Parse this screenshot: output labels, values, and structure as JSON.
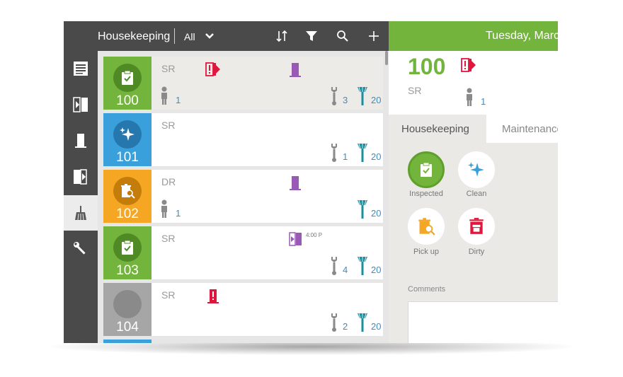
{
  "header": {
    "title": "Housekeeping",
    "filter_label": "All",
    "date": "Tuesday, March"
  },
  "icons": {
    "sort": "sort-icon",
    "filter": "filter-icon",
    "search": "search-icon",
    "add": "plus-icon"
  },
  "sidebar": {
    "items": [
      {
        "name": "list"
      },
      {
        "name": "arrival"
      },
      {
        "name": "stay"
      },
      {
        "name": "departure"
      },
      {
        "name": "housekeeping"
      },
      {
        "name": "maintenance"
      }
    ]
  },
  "rooms": [
    {
      "number": "100",
      "type": "SR",
      "status": "inspected",
      "guests": "1",
      "maintenance": "3",
      "cleaning": "20"
    },
    {
      "number": "101",
      "type": "SR",
      "status": "clean",
      "guests": "",
      "maintenance": "1",
      "cleaning": "20"
    },
    {
      "number": "102",
      "type": "DR",
      "status": "pickup",
      "guests": "1",
      "maintenance": "",
      "cleaning": "20"
    },
    {
      "number": "103",
      "type": "SR",
      "status": "inspected",
      "guests": "",
      "maintenance": "4",
      "cleaning": "20",
      "time": "4:00 P"
    },
    {
      "number": "104",
      "type": "SR",
      "status": "none",
      "guests": "",
      "maintenance": "2",
      "cleaning": "20"
    }
  ],
  "detail": {
    "number": "100",
    "type": "SR",
    "guests": "1",
    "tabs": {
      "housekeeping": "Housekeeping",
      "maintenance": "Maintenance"
    },
    "status_options": {
      "inspected": "Inspected",
      "clean": "Clean",
      "pickup": "Pick up",
      "dirty": "Dirty"
    },
    "comments_label": "Comments"
  },
  "colors": {
    "green": "#73b43c",
    "blue": "#3aa0dc",
    "orange": "#f5a623",
    "gray": "#a6a6a6",
    "red": "#e0173c",
    "purple": "#9b59b6",
    "teal": "#1a8fa0",
    "dark": "#4a4a4a"
  }
}
